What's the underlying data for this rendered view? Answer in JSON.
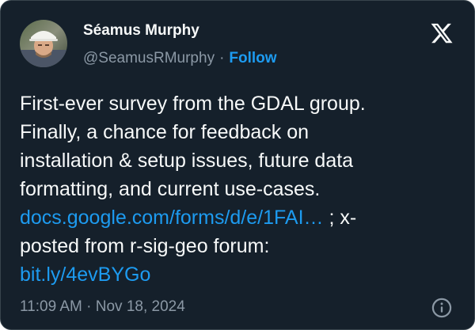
{
  "author": {
    "display_name": "Séamus Murphy",
    "handle": "@SeamusRMurphy",
    "separator": "·",
    "follow_label": "Follow"
  },
  "tweet": {
    "line1": "First-ever survey from the GDAL group.",
    "line2": "Finally, a chance for feedback on",
    "line3": "installation & setup issues, future data",
    "line4": "formatting, and current use-cases.",
    "link1": "docs.google.com/forms/d/e/1FAI…",
    "line5_rest": " ; x-",
    "line6": "posted from r-sig-geo forum:",
    "link2": "bit.ly/4evBYGo"
  },
  "meta": {
    "timestamp": "11:09 AM · Nov 18, 2024"
  },
  "icons": {
    "logo": "x-logo-icon",
    "info": "info-icon",
    "avatar": "avatar-photo"
  },
  "colors": {
    "background": "#15202b",
    "text": "#f7f9f9",
    "secondary": "#8b98a5",
    "accent": "#1d9bf0"
  }
}
